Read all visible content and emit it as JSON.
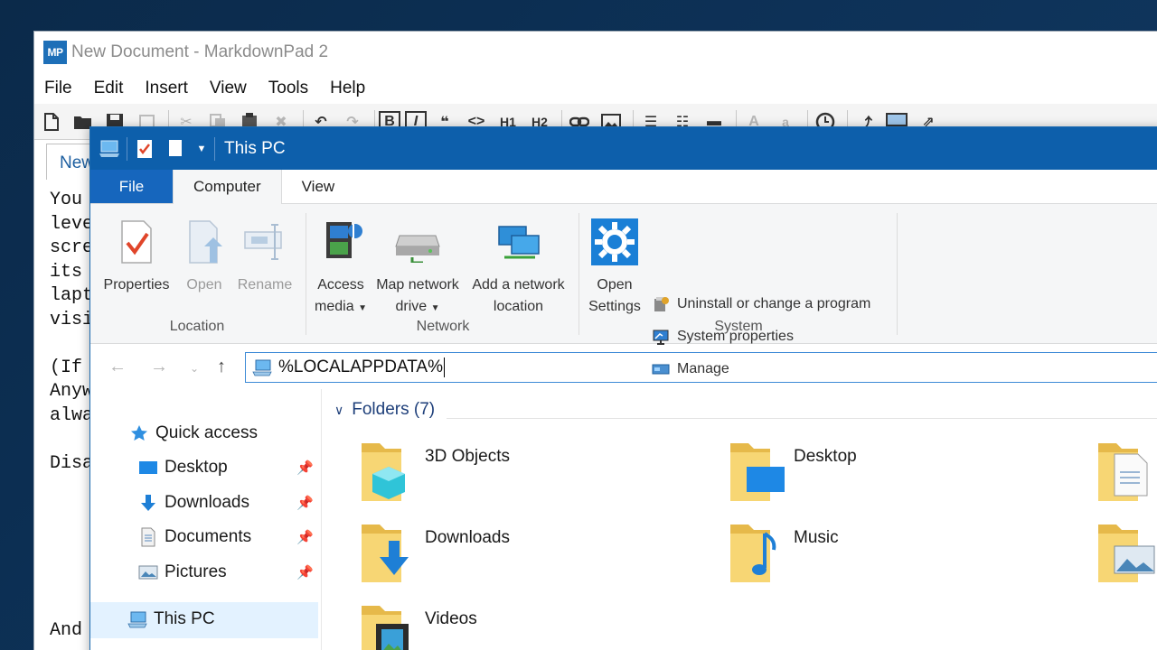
{
  "markdownpad": {
    "logo": "MP",
    "title": "New Document - MarkdownPad 2",
    "menu": [
      "File",
      "Edit",
      "Insert",
      "View",
      "Tools",
      "Help"
    ],
    "tab_label": "New",
    "editor_lines": [
      "You",
      "leve",
      "scre",
      "its",
      "lapt",
      "visi",
      "",
      "(If",
      "Anyw",
      "alwa",
      "",
      "Disa",
      "",
      "",
      "",
      "",
      "",
      "",
      "And"
    ]
  },
  "explorer": {
    "title": "This PC",
    "tabs": {
      "file": "File",
      "computer": "Computer",
      "view": "View"
    },
    "ribbon": {
      "location": {
        "label": "Location",
        "properties": "Properties",
        "open": "Open",
        "rename": "Rename"
      },
      "network": {
        "label": "Network",
        "access_media_1": "Access",
        "access_media_2": "media",
        "map_drive_1": "Map network",
        "map_drive_2": "drive",
        "add_location_1": "Add a network",
        "add_location_2": "location"
      },
      "system": {
        "label": "System",
        "open_settings_1": "Open",
        "open_settings_2": "Settings",
        "uninstall": "Uninstall or change a program",
        "system_properties": "System properties",
        "manage": "Manage"
      }
    },
    "address": {
      "value": "%LOCALAPPDATA%"
    },
    "nav_pane": {
      "quick_access": "Quick access",
      "desktop": "Desktop",
      "downloads": "Downloads",
      "documents": "Documents",
      "pictures": "Pictures",
      "this_pc": "This PC"
    },
    "content": {
      "folders_header": "Folders (7)",
      "folders": [
        "3D Objects",
        "Desktop",
        "Downloads",
        "Music",
        "Videos"
      ]
    }
  }
}
